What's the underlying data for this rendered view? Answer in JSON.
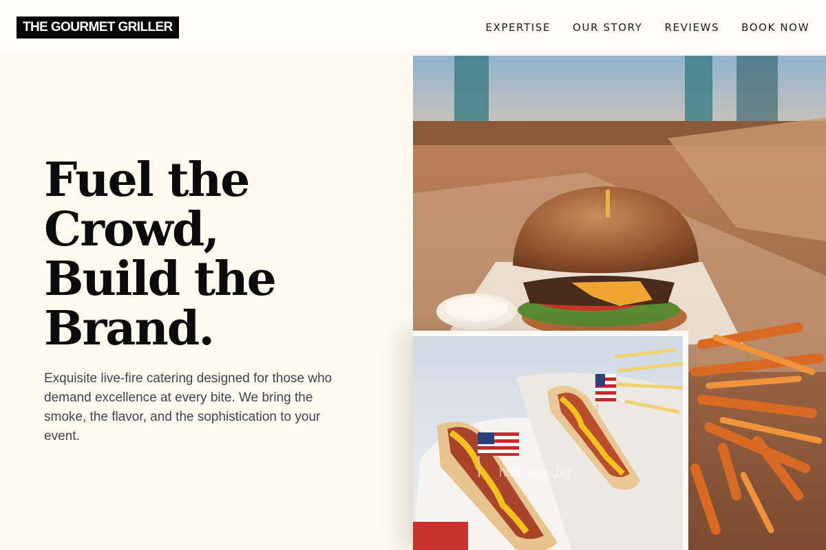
{
  "header": {
    "logo": "THE GOURMET GRILLER",
    "nav": [
      {
        "label": "EXPERTISE"
      },
      {
        "label": "OUR STORY"
      },
      {
        "label": "REVIEWS"
      },
      {
        "label": "BOOK NOW"
      }
    ]
  },
  "hero": {
    "headline_lines": [
      "Fuel the",
      "Crowd,",
      "Build the",
      "Brand."
    ],
    "subtext": "Exquisite live-fire catering designed for those who demand excellence at every bite. We bring the smoke, the flavor, and the sophistication to your event."
  },
  "images": {
    "burger_photo": "burger-and-fries-photo",
    "hotdog_photo": "hot-dogs-with-flags-photo",
    "hotdog_watermark": "hotdoggy.biz"
  },
  "colors": {
    "page_bg": "#fdf9ef",
    "logo_bg": "#050505",
    "headline": "#0b0b0b",
    "subtext": "#3f4451"
  }
}
